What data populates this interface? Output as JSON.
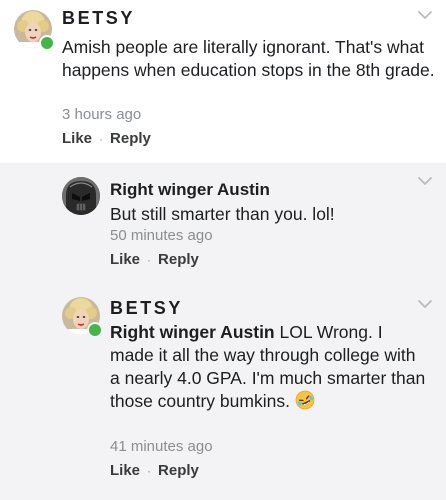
{
  "comments": [
    {
      "author": "BETSY",
      "text": "Amish people are literally ignorant. That's what happens when education stops in the 8th grade.",
      "time": "3 hours ago",
      "like": "Like",
      "sep": "·",
      "reply": "Reply"
    }
  ],
  "replies": [
    {
      "author": "Right winger Austin",
      "text": "But still smarter than you. lol!",
      "time": "50 minutes ago",
      "like": "Like",
      "sep": "·",
      "reply": "Reply"
    },
    {
      "author": "BETSY",
      "mention": "Right winger Austin",
      "text": " LOL Wrong. I made it all the way through college with a nearly 4.0 GPA. I'm much smarter than those country bumkins. ",
      "emoji": "rofl-emoji",
      "time": "41 minutes ago",
      "like": "Like",
      "sep": "·",
      "reply": "Reply"
    }
  ],
  "colors": {
    "online": "#44b649",
    "reply_background": "#f3f3f5",
    "muted_text": "#8a8d91"
  },
  "icons": [
    "chevron-down-icon",
    "online-status-icon",
    "rofl-emoji"
  ]
}
